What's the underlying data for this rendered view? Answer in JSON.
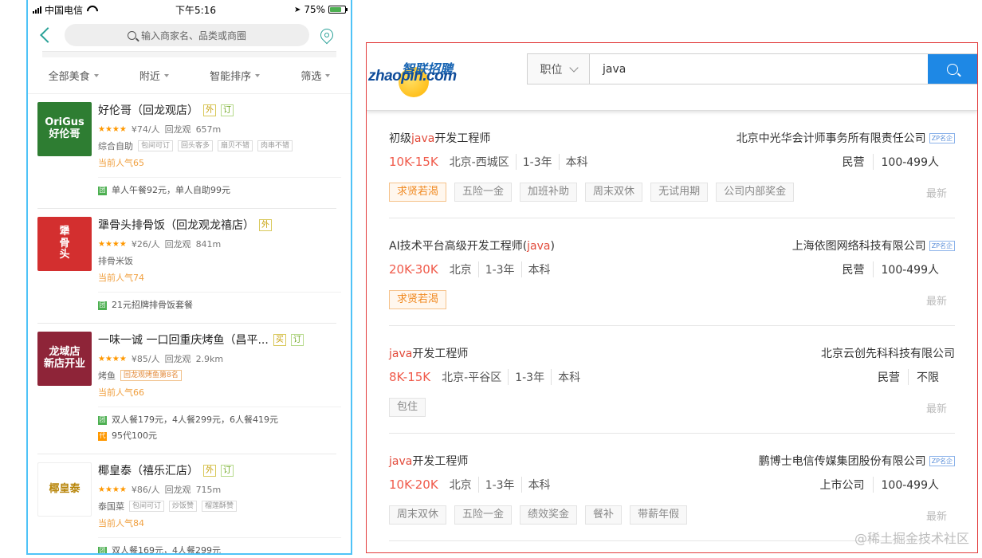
{
  "phone": {
    "status": {
      "carrier": "中国电信",
      "time": "下午5:16",
      "battery": "75%"
    },
    "search_placeholder": "输入商家名、品类或商圈",
    "filters": [
      "全部美食",
      "附近",
      "智能排序",
      "筛选"
    ],
    "shops": [
      {
        "thumb_text": "OriGus\n好伦哥",
        "thumb_color": "#2e7d32",
        "name": "好伦哥（回龙观店）",
        "badges": [
          "外",
          "订"
        ],
        "stars": "★★★★",
        "price": "¥74/人",
        "area": "回龙观",
        "distance": "657m",
        "category": "综合自助",
        "tags": [
          "包间可订",
          "回头客多",
          "扇贝不错",
          "肉串不错"
        ],
        "popularity": "当前人气65",
        "deals": [
          {
            "icon": "团",
            "text": "单人午餐92元，单人自助99元"
          }
        ]
      },
      {
        "thumb_text": "犟\n骨\n头",
        "thumb_color": "#d32f2f",
        "name": "犟骨头排骨饭（回龙观龙禧店）",
        "badges": [
          "外"
        ],
        "stars": "★★★★",
        "price": "¥26/人",
        "area": "回龙观",
        "distance": "841m",
        "category": "排骨米饭",
        "tags": [],
        "popularity": "当前人气74",
        "deals": [
          {
            "icon": "团",
            "text": "21元招牌排骨饭套餐"
          }
        ]
      },
      {
        "thumb_text": "龙域店\n新店开业",
        "thumb_color": "#8e2438",
        "name": "一味一诚 一口回重庆烤鱼（昌平...",
        "badges": [
          "买",
          "订"
        ],
        "stars": "★★★★",
        "price": "¥85/人",
        "area": "回龙观",
        "distance": "2.9km",
        "category": "烤鱼",
        "tags": [
          "回龙观烤鱼第8名"
        ],
        "popularity": "当前人气66",
        "deals": [
          {
            "icon": "团",
            "text": "双人餐179元，4人餐299元，6人餐419元"
          },
          {
            "icon": "代",
            "text": "95代100元"
          }
        ]
      },
      {
        "thumb_text": "椰皇泰",
        "thumb_color": "#ffffff",
        "name": "椰皇泰（禧乐汇店）",
        "badges": [
          "外",
          "订"
        ],
        "stars": "★★★★",
        "price": "¥86/人",
        "area": "回龙观",
        "distance": "715m",
        "category": "泰国菜",
        "tags": [
          "包间可订",
          "炒饭赞",
          "榴莲酥赞"
        ],
        "popularity": "当前人气84",
        "deals": [
          {
            "icon": "团",
            "text": "双人餐169元，4人餐299元"
          }
        ]
      }
    ]
  },
  "jobs": {
    "logo": {
      "cn": "智联招聘",
      "en": "zhaopin.com"
    },
    "search": {
      "category": "职位",
      "query": "java"
    },
    "newest_label": "最新",
    "list": [
      {
        "title_pre": "初级",
        "title_kw": "java",
        "title_post": "开发工程师",
        "company": "北京中光华会计师事务所有限责任公司",
        "zp": "ZP名企",
        "salary": "10K-15K",
        "details": [
          "北京-西城区",
          "1-3年",
          "本科"
        ],
        "company_meta": [
          "民营",
          "100-499人"
        ],
        "tags": [
          {
            "t": "求贤若渴",
            "hot": true
          },
          {
            "t": "五险一金"
          },
          {
            "t": "加班补助"
          },
          {
            "t": "周末双休"
          },
          {
            "t": "无试用期"
          },
          {
            "t": "公司内部奖金"
          }
        ]
      },
      {
        "title_pre": "AI技术平台高级开发工程师(",
        "title_kw": "java",
        "title_post": ")",
        "company": "上海依图网络科技有限公司",
        "zp": "ZP名企",
        "salary": "20K-30K",
        "details": [
          "北京",
          "1-3年",
          "本科"
        ],
        "company_meta": [
          "民营",
          "100-499人"
        ],
        "tags": [
          {
            "t": "求贤若渴",
            "hot": true
          }
        ]
      },
      {
        "title_pre": "",
        "title_kw": "java",
        "title_post": "开发工程师",
        "company": "北京云创先科科技有限公司",
        "zp": "",
        "salary": "8K-15K",
        "details": [
          "北京-平谷区",
          "1-3年",
          "本科"
        ],
        "company_meta": [
          "民营",
          "不限"
        ],
        "tags": [
          {
            "t": "包住"
          }
        ]
      },
      {
        "title_pre": "",
        "title_kw": "java",
        "title_post": "开发工程师",
        "company": "鹏博士电信传媒集团股份有限公司",
        "zp": "ZP名企",
        "salary": "10K-20K",
        "details": [
          "北京",
          "1-3年",
          "本科"
        ],
        "company_meta": [
          "上市公司",
          "100-499人"
        ],
        "tags": [
          {
            "t": "周末双休"
          },
          {
            "t": "五险一金"
          },
          {
            "t": "绩效奖金"
          },
          {
            "t": "餐补"
          },
          {
            "t": "带薪年假"
          }
        ]
      }
    ]
  },
  "watermark": "@稀土掘金技术社区"
}
